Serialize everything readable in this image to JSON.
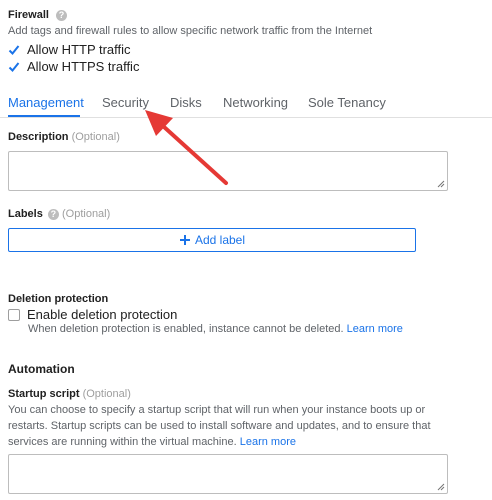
{
  "firewall": {
    "title": "Firewall",
    "description": "Add tags and firewall rules to allow specific network traffic from the Internet",
    "http_label": "Allow HTTP traffic",
    "http_checked": true,
    "https_label": "Allow HTTPS traffic",
    "https_checked": true
  },
  "tabs": [
    {
      "label": "Management",
      "active": true
    },
    {
      "label": "Security",
      "active": false
    },
    {
      "label": "Disks",
      "active": false
    },
    {
      "label": "Networking",
      "active": false
    },
    {
      "label": "Sole Tenancy",
      "active": false
    }
  ],
  "description_field": {
    "label": "Description",
    "optional": "(Optional)",
    "value": ""
  },
  "labels": {
    "label": "Labels",
    "optional": "(Optional)",
    "add_button": "Add label",
    "add_icon": "plus-icon"
  },
  "deletion": {
    "title": "Deletion protection",
    "checkbox_label": "Enable deletion protection",
    "checked": false,
    "help": "When deletion protection is enabled, instance cannot be deleted.",
    "learn_more": "Learn more"
  },
  "automation": {
    "title": "Automation",
    "startup_label": "Startup script",
    "optional": "(Optional)",
    "help": "You can choose to specify a startup script that will run when your instance boots up or restarts. Startup scripts can be used to install software and updates, and to ensure that services are running within the virtual machine.",
    "learn_more": "Learn more",
    "value": ""
  },
  "colors": {
    "accent": "#1a73e8",
    "annotation_arrow": "#e53935"
  }
}
